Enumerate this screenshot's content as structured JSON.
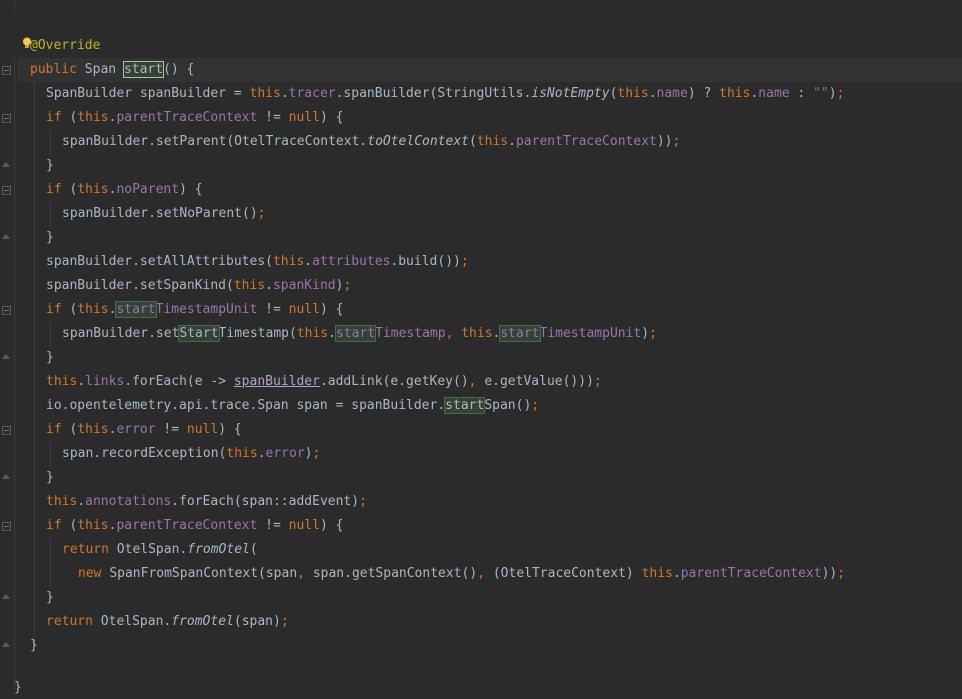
{
  "editor": {
    "lines": [
      {
        "indent": 0,
        "tokens": [
          {
            "t": "@Override",
            "c": "ann"
          }
        ]
      },
      {
        "indent": 0,
        "tokens": [
          {
            "t": "public ",
            "c": "kw"
          },
          {
            "t": "Span "
          },
          {
            "t": "start",
            "c": "hl-decl"
          },
          {
            "t": "() {"
          }
        ]
      },
      {
        "indent": 1,
        "tokens": [
          {
            "t": "SpanBuilder spanBuilder = "
          },
          {
            "t": "this",
            "c": "kw"
          },
          {
            "t": "."
          },
          {
            "t": "tracer",
            "c": "fld"
          },
          {
            "t": ".spanBuilder(StringUtils."
          },
          {
            "t": "isNotEmpty",
            "c": "it"
          },
          {
            "t": "("
          },
          {
            "t": "this",
            "c": "kw"
          },
          {
            "t": "."
          },
          {
            "t": "name",
            "c": "fld"
          },
          {
            "t": ") ? "
          },
          {
            "t": "this",
            "c": "kw"
          },
          {
            "t": "."
          },
          {
            "t": "name",
            "c": "fld"
          },
          {
            "t": " : "
          },
          {
            "t": "\"\"",
            "c": "str"
          },
          {
            "t": ")"
          },
          {
            "t": ";",
            "c": "punc"
          }
        ]
      },
      {
        "indent": 1,
        "tokens": [
          {
            "t": "if ",
            "c": "kw"
          },
          {
            "t": "("
          },
          {
            "t": "this",
            "c": "kw"
          },
          {
            "t": "."
          },
          {
            "t": "parentTraceContext",
            "c": "fld"
          },
          {
            "t": " != "
          },
          {
            "t": "null",
            "c": "kw"
          },
          {
            "t": ") {"
          }
        ]
      },
      {
        "indent": 2,
        "tokens": [
          {
            "t": "spanBuilder.setParent(OtelTraceContext."
          },
          {
            "t": "toOtelContext",
            "c": "it"
          },
          {
            "t": "("
          },
          {
            "t": "this",
            "c": "kw"
          },
          {
            "t": "."
          },
          {
            "t": "parentTraceContext",
            "c": "fld"
          },
          {
            "t": "))"
          },
          {
            "t": ";",
            "c": "punc"
          }
        ]
      },
      {
        "indent": 1,
        "tokens": [
          {
            "t": "}"
          }
        ]
      },
      {
        "indent": 1,
        "tokens": [
          {
            "t": "if ",
            "c": "kw"
          },
          {
            "t": "("
          },
          {
            "t": "this",
            "c": "kw"
          },
          {
            "t": "."
          },
          {
            "t": "noParent",
            "c": "fld"
          },
          {
            "t": ") {"
          }
        ]
      },
      {
        "indent": 2,
        "tokens": [
          {
            "t": "spanBuilder.setNoParent()"
          },
          {
            "t": ";",
            "c": "punc"
          }
        ]
      },
      {
        "indent": 1,
        "tokens": [
          {
            "t": "}"
          }
        ]
      },
      {
        "indent": 1,
        "tokens": [
          {
            "t": "spanBuilder.setAllAttributes("
          },
          {
            "t": "this",
            "c": "kw"
          },
          {
            "t": "."
          },
          {
            "t": "attributes",
            "c": "fld"
          },
          {
            "t": ".build())"
          },
          {
            "t": ";",
            "c": "punc"
          }
        ]
      },
      {
        "indent": 1,
        "tokens": [
          {
            "t": "spanBuilder.setSpanKind("
          },
          {
            "t": "this",
            "c": "kw"
          },
          {
            "t": "."
          },
          {
            "t": "spanKind",
            "c": "fld"
          },
          {
            "t": ")"
          },
          {
            "t": ";",
            "c": "punc"
          }
        ]
      },
      {
        "indent": 1,
        "tokens": [
          {
            "t": "if ",
            "c": "kw"
          },
          {
            "t": "("
          },
          {
            "t": "this",
            "c": "kw"
          },
          {
            "t": "."
          },
          {
            "t": "start",
            "c": "fld hl"
          },
          {
            "t": "TimestampUnit",
            "c": "fld"
          },
          {
            "t": " != "
          },
          {
            "t": "null",
            "c": "kw"
          },
          {
            "t": ") {"
          }
        ]
      },
      {
        "indent": 2,
        "tokens": [
          {
            "t": "spanBuilder.set"
          },
          {
            "t": "Start",
            "c": "hl"
          },
          {
            "t": "Timestamp("
          },
          {
            "t": "this",
            "c": "kw"
          },
          {
            "t": "."
          },
          {
            "t": "start",
            "c": "fld hl"
          },
          {
            "t": "Timestamp",
            "c": "fld"
          },
          {
            "t": ", ",
            "c": "punc"
          },
          {
            "t": "this",
            "c": "kw"
          },
          {
            "t": "."
          },
          {
            "t": "start",
            "c": "fld hl"
          },
          {
            "t": "TimestampUnit",
            "c": "fld"
          },
          {
            "t": ")"
          },
          {
            "t": ";",
            "c": "punc"
          }
        ]
      },
      {
        "indent": 1,
        "tokens": [
          {
            "t": "}"
          }
        ]
      },
      {
        "indent": 1,
        "tokens": [
          {
            "t": "this",
            "c": "kw"
          },
          {
            "t": "."
          },
          {
            "t": "links",
            "c": "fld"
          },
          {
            "t": ".forEach(e -> "
          },
          {
            "t": "spanBuilder",
            "c": "ul"
          },
          {
            "t": ".addLink(e.getKey()"
          },
          {
            "t": ", ",
            "c": "punc"
          },
          {
            "t": "e.getValue()))"
          },
          {
            "t": ";",
            "c": "punc"
          }
        ]
      },
      {
        "indent": 1,
        "tokens": [
          {
            "t": "io.opentelemetry.api.trace.Span span = spanBuilder."
          },
          {
            "t": "start",
            "c": "hl"
          },
          {
            "t": "Span()"
          },
          {
            "t": ";",
            "c": "punc"
          }
        ]
      },
      {
        "indent": 1,
        "tokens": [
          {
            "t": "if ",
            "c": "kw"
          },
          {
            "t": "("
          },
          {
            "t": "this",
            "c": "kw"
          },
          {
            "t": "."
          },
          {
            "t": "error",
            "c": "fld"
          },
          {
            "t": " != "
          },
          {
            "t": "null",
            "c": "kw"
          },
          {
            "t": ") {"
          }
        ]
      },
      {
        "indent": 2,
        "tokens": [
          {
            "t": "span.recordException("
          },
          {
            "t": "this",
            "c": "kw"
          },
          {
            "t": "."
          },
          {
            "t": "error",
            "c": "fld"
          },
          {
            "t": ")"
          },
          {
            "t": ";",
            "c": "punc"
          }
        ]
      },
      {
        "indent": 1,
        "tokens": [
          {
            "t": "}"
          }
        ]
      },
      {
        "indent": 1,
        "tokens": [
          {
            "t": "this",
            "c": "kw"
          },
          {
            "t": "."
          },
          {
            "t": "annotations",
            "c": "fld"
          },
          {
            "t": ".forEach(span::addEvent)"
          },
          {
            "t": ";",
            "c": "punc"
          }
        ]
      },
      {
        "indent": 1,
        "tokens": [
          {
            "t": "if ",
            "c": "kw"
          },
          {
            "t": "("
          },
          {
            "t": "this",
            "c": "kw"
          },
          {
            "t": "."
          },
          {
            "t": "parentTraceContext",
            "c": "fld"
          },
          {
            "t": " != "
          },
          {
            "t": "null",
            "c": "kw"
          },
          {
            "t": ") {"
          }
        ]
      },
      {
        "indent": 2,
        "tokens": [
          {
            "t": "return ",
            "c": "kw"
          },
          {
            "t": "OtelSpan."
          },
          {
            "t": "fromOtel",
            "c": "it"
          },
          {
            "t": "("
          }
        ]
      },
      {
        "indent": 3,
        "tokens": [
          {
            "t": "new ",
            "c": "kw"
          },
          {
            "t": "SpanFromSpanContext(span"
          },
          {
            "t": ", ",
            "c": "punc"
          },
          {
            "t": "span.getSpanContext()"
          },
          {
            "t": ", ",
            "c": "punc"
          },
          {
            "t": "(OtelTraceContext) "
          },
          {
            "t": "this",
            "c": "kw"
          },
          {
            "t": "."
          },
          {
            "t": "parentTraceContext",
            "c": "fld"
          },
          {
            "t": "))"
          },
          {
            "t": ";",
            "c": "punc"
          }
        ]
      },
      {
        "indent": 1,
        "tokens": [
          {
            "t": "}"
          }
        ]
      },
      {
        "indent": 1,
        "tokens": [
          {
            "t": "return ",
            "c": "kw"
          },
          {
            "t": "OtelSpan."
          },
          {
            "t": "fromOtel",
            "c": "it"
          },
          {
            "t": "(span)"
          },
          {
            "t": ";",
            "c": "punc"
          }
        ]
      },
      {
        "indent": 0,
        "tokens": [
          {
            "t": "}"
          }
        ]
      }
    ],
    "top_brace": "}",
    "bottom_brace": "}"
  }
}
